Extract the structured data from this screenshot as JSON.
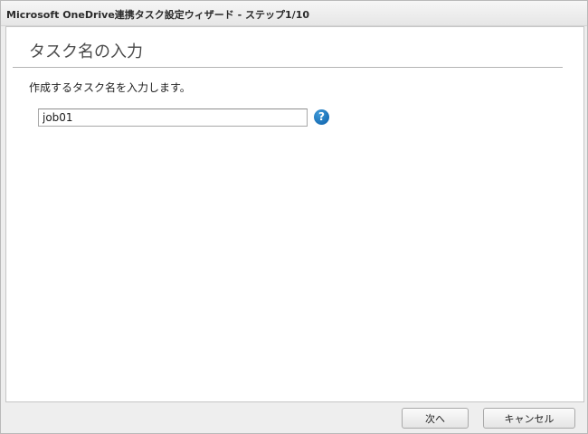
{
  "window": {
    "title": "Microsoft OneDrive連携タスク設定ウィザード - ステップ1/10"
  },
  "main": {
    "page_title": "タスク名の入力",
    "instruction": "作成するタスク名を入力します。",
    "task_name_input": {
      "value": "job01",
      "placeholder": ""
    },
    "help_icon": {
      "icon": "help-question-icon",
      "glyph": "?",
      "color": "#0a6bb5"
    }
  },
  "footer": {
    "next_label": "次へ",
    "cancel_label": "キャンセル"
  }
}
